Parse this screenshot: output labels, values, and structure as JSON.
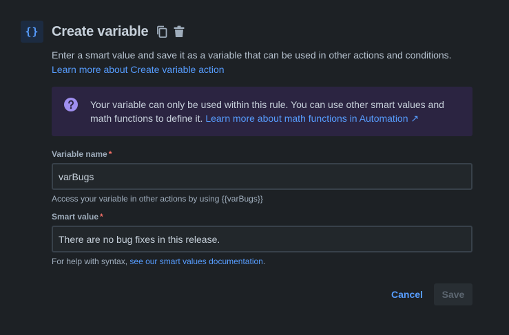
{
  "header": {
    "badge_text": "{}",
    "title": "Create variable",
    "icons": [
      "copy-icon",
      "trash-icon"
    ]
  },
  "description": {
    "text": "Enter a smart value and save it as a variable that can be used in other actions and conditions.",
    "link": "Learn more about Create variable action"
  },
  "note": {
    "icon": "question-circle-icon",
    "text": "Your variable can only be used within this rule. You can use other smart values and math functions to define it.",
    "link": "Learn more about math functions in Automation",
    "link_arrow": "↗"
  },
  "variable_name": {
    "label": "Variable name",
    "required_mark": "*",
    "value": "varBugs",
    "hint": "Access your variable in other actions by using {{varBugs}}"
  },
  "smart_value": {
    "label": "Smart value",
    "required_mark": "*",
    "value": "There are no bug fixes in this release.",
    "hint_prefix": "For help with syntax,",
    "hint_link": "see our smart values documentation",
    "hint_suffix": "."
  },
  "actions": {
    "cancel_label": "Cancel",
    "save_label": "Save"
  },
  "colors": {
    "background": "#1d2125",
    "accent": "#579dff",
    "note_background": "#2b2441",
    "note_icon": "#9f8fef",
    "required": "#f87168"
  }
}
